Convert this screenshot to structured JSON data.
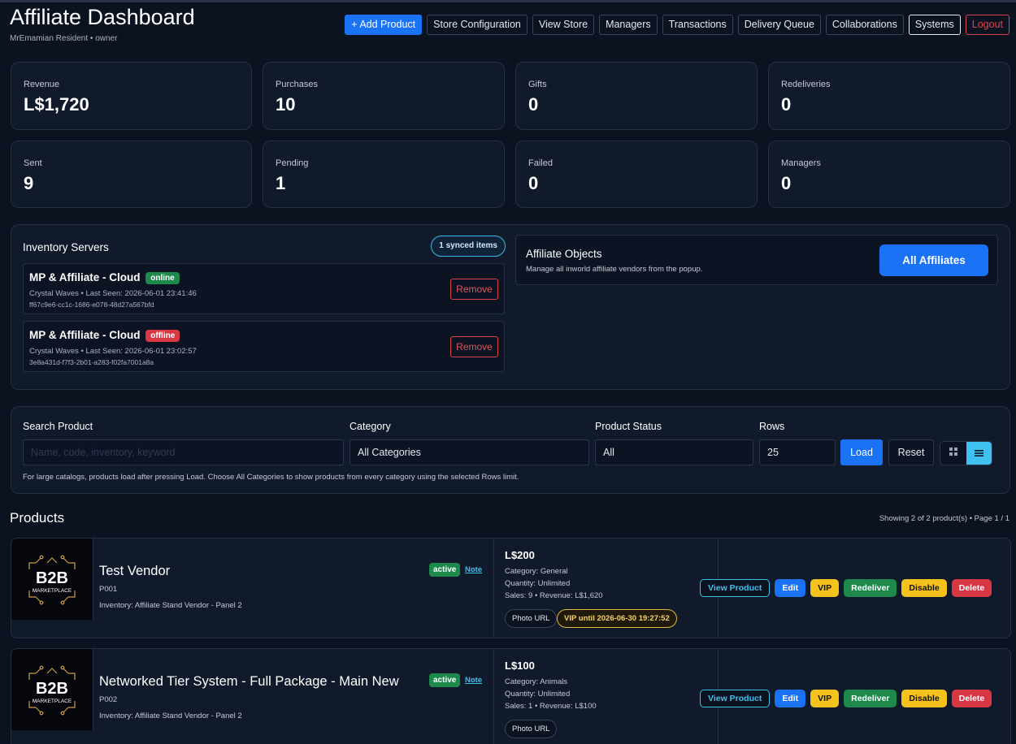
{
  "header": {
    "title": "Affiliate Dashboard",
    "subtitle": "MrEmamian Resident • owner",
    "nav": {
      "add_product": "+ Add Product",
      "store_configuration": "Store Configuration",
      "view_store": "View Store",
      "managers": "Managers",
      "transactions": "Transactions",
      "delivery_queue": "Delivery Queue",
      "collaborations": "Collaborations",
      "systems": "Systems",
      "logout": "Logout"
    }
  },
  "stats": [
    {
      "label": "Revenue",
      "value": "L$1,720"
    },
    {
      "label": "Purchases",
      "value": "10"
    },
    {
      "label": "Gifts",
      "value": "0"
    },
    {
      "label": "Redeliveries",
      "value": "0"
    },
    {
      "label": "Sent",
      "value": "9"
    },
    {
      "label": "Pending",
      "value": "1"
    },
    {
      "label": "Failed",
      "value": "0"
    },
    {
      "label": "Managers",
      "value": "0"
    }
  ],
  "inventory": {
    "title": "Inventory Servers",
    "synced_badge": "1 synced items",
    "servers": [
      {
        "name": "MP & Affiliate - Cloud",
        "status": "online",
        "meta": "Crystal Waves • Last Seen: 2026-06-01 23:41:46",
        "uuid": "ff67c9e6-cc1c-1686-e078-48d27a567bfd",
        "remove_label": "Remove"
      },
      {
        "name": "MP & Affiliate - Cloud",
        "status": "offline",
        "meta": "Crystal Waves • Last Seen: 2026-06-01 23:02:57",
        "uuid": "3e8a431d-f7f3-2b01-a283-f02fa7001a8a",
        "remove_label": "Remove"
      }
    ]
  },
  "affiliate_objects": {
    "title": "Affiliate Objects",
    "description": "Manage all inworld affiliate vendors from the popup.",
    "button": "All Affiliates"
  },
  "filters": {
    "search_label": "Search Product",
    "search_placeholder": "Name, code, inventory, keyword",
    "search_value": "",
    "category_label": "Category",
    "category_value": "All Categories",
    "status_label": "Product Status",
    "status_value": "All",
    "rows_label": "Rows",
    "rows_value": "25",
    "load": "Load",
    "reset": "Reset",
    "hint": "For large catalogs, products load after pressing Load. Choose All Categories to show products from every category using the selected Rows limit."
  },
  "products_section": {
    "title": "Products",
    "showing": "Showing 2 of 2 product(s) • Page 1 / 1"
  },
  "products": [
    {
      "name": "Test Vendor",
      "code": "P001",
      "inventory": "Inventory: Affiliate Stand Vendor - Panel 2",
      "status": "active",
      "note": "Note",
      "price": "L$200",
      "category": "Category: General",
      "quantity": "Quantity: Unlimited",
      "sales": "Sales: 9 • Revenue: L$1,620",
      "photo_url": "Photo URL",
      "vip_until": "VIP until 2026-06-30 19:27:52",
      "logo_text": "B2B",
      "logo_sub": "MARKETPLACE"
    },
    {
      "name": "Networked Tier System - Full Package - Main New",
      "code": "P002",
      "inventory": "Inventory: Affiliate Stand Vendor - Panel 2",
      "status": "active",
      "note": "Note",
      "price": "L$100",
      "category": "Category: Animals",
      "quantity": "Quantity: Unlimited",
      "sales": "Sales: 1 • Revenue: L$100",
      "photo_url": "Photo URL",
      "logo_text": "B2B",
      "logo_sub": "MARKETPLACE"
    }
  ],
  "product_actions": {
    "view": "View Product",
    "edit": "Edit",
    "vip": "VIP",
    "redeliver": "Redeliver",
    "disable": "Disable",
    "delete": "Delete"
  },
  "icons": {
    "grid_view": "grid-icon",
    "list_view": "list-icon"
  },
  "colors": {
    "background": "#0b1220",
    "card": "#111a2b",
    "primary": "#1a73f5",
    "success": "#1d8a4c",
    "danger": "#d93743",
    "warning": "#f4c21b",
    "info": "#3fc0f0"
  }
}
